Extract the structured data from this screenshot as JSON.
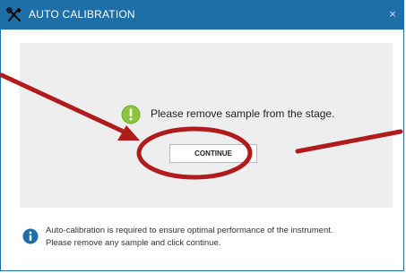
{
  "dialog": {
    "title": "AUTO CALIBRATION",
    "close_glyph": "×",
    "title_icon": "tools-icon",
    "accent_color": "#1e6fa8"
  },
  "panel": {
    "message": "Please remove sample from the stage.",
    "message_icon": "exclamation-icon",
    "continue_label": "CONTINUE"
  },
  "footer": {
    "info_icon": "info-icon",
    "line1": "Auto-calibration is required to ensure optimal performance of the instrument.",
    "line2": "Please remove any sample and click continue."
  },
  "annotation": {
    "color": "#b01c1c",
    "shapes": [
      "arrow-left",
      "circle",
      "arrow-right"
    ]
  }
}
